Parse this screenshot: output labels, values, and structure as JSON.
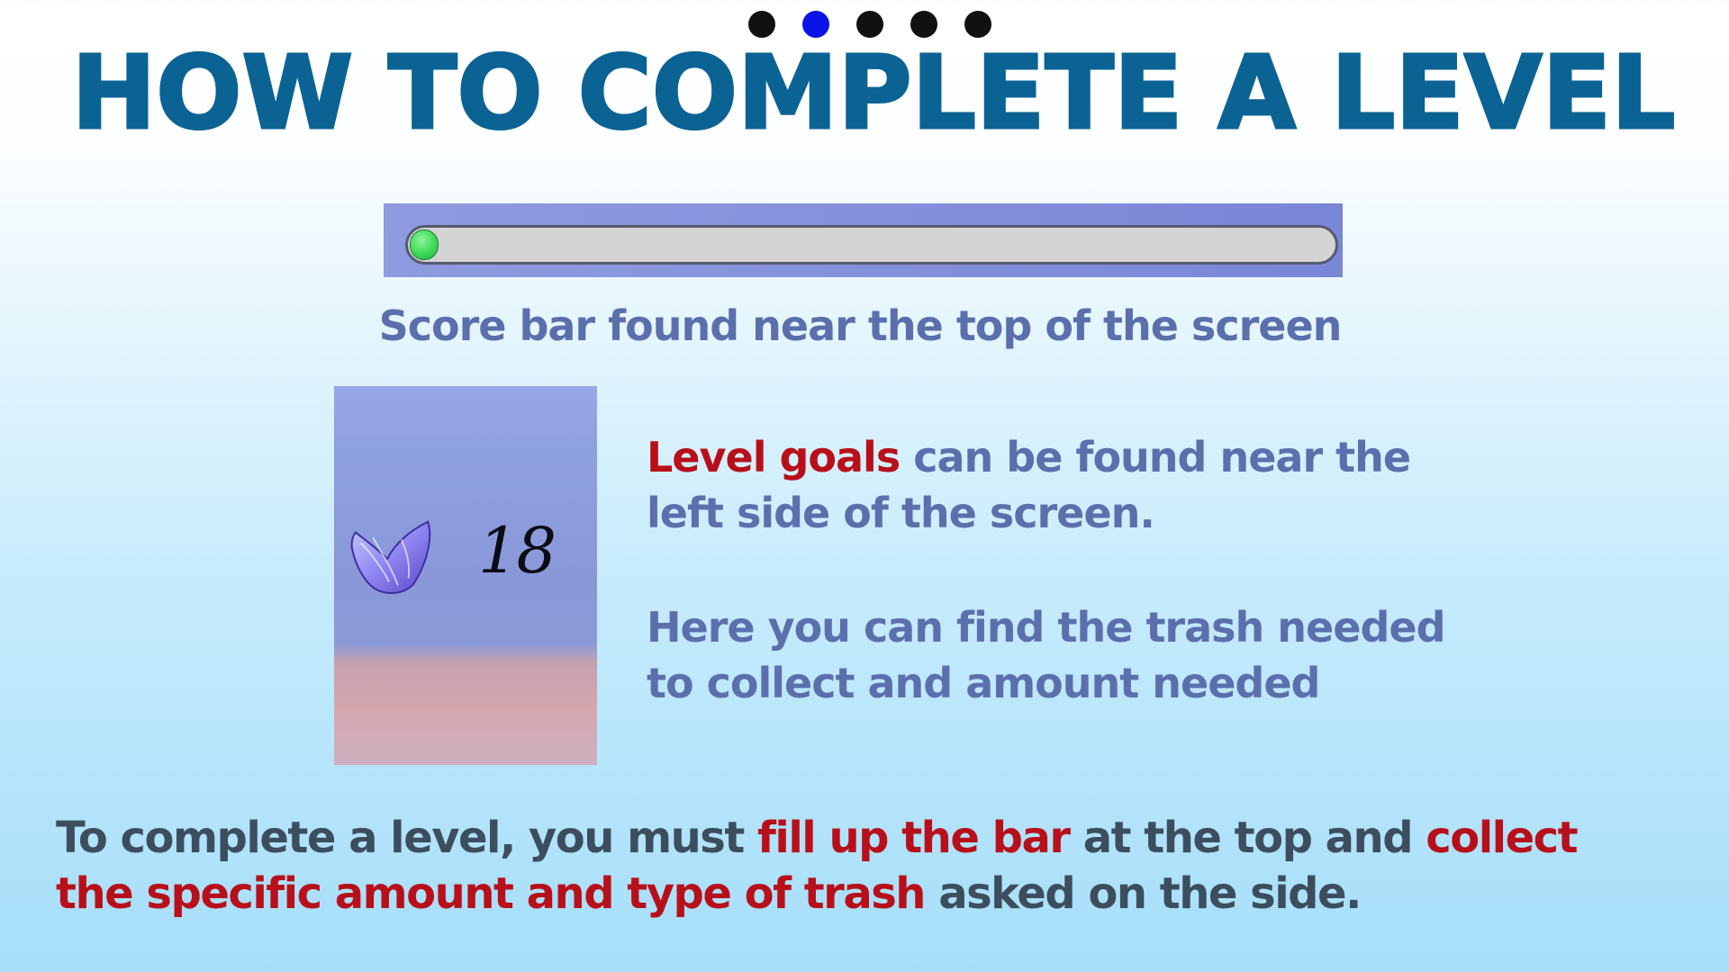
{
  "pager": {
    "total": 5,
    "active_index": 1,
    "colors": {
      "inactive": "#111111",
      "active": "#0a14e6"
    }
  },
  "title": "HOW TO COMPLETE A LEVEL",
  "score_bar": {
    "fill_fraction": 0.03,
    "caption": "Score bar found near the top of the screen"
  },
  "goal_panel": {
    "icon": "purple-trash-bag-icon",
    "count": "18"
  },
  "goal_description": {
    "line1_highlight_a": "Level",
    "line1_highlight_b": "goals",
    "line1_rest": "can be found near the",
    "line2": "left side of the screen.",
    "line3": "Here you can find the trash needed",
    "line4": "to collect and amount needed"
  },
  "bottom_instruction": {
    "part1": "To complete a level, you must",
    "highlight1": "fill up the bar",
    "part2": "at the top and",
    "highlight2a": "collect",
    "highlight2b": "the specific amount and type of trash",
    "part3": "asked on the side."
  },
  "colors": {
    "title": "#0b6394",
    "body_text": "#5b6fad",
    "highlight": "#b8101a",
    "bottom_text": "#3c4e5e"
  }
}
